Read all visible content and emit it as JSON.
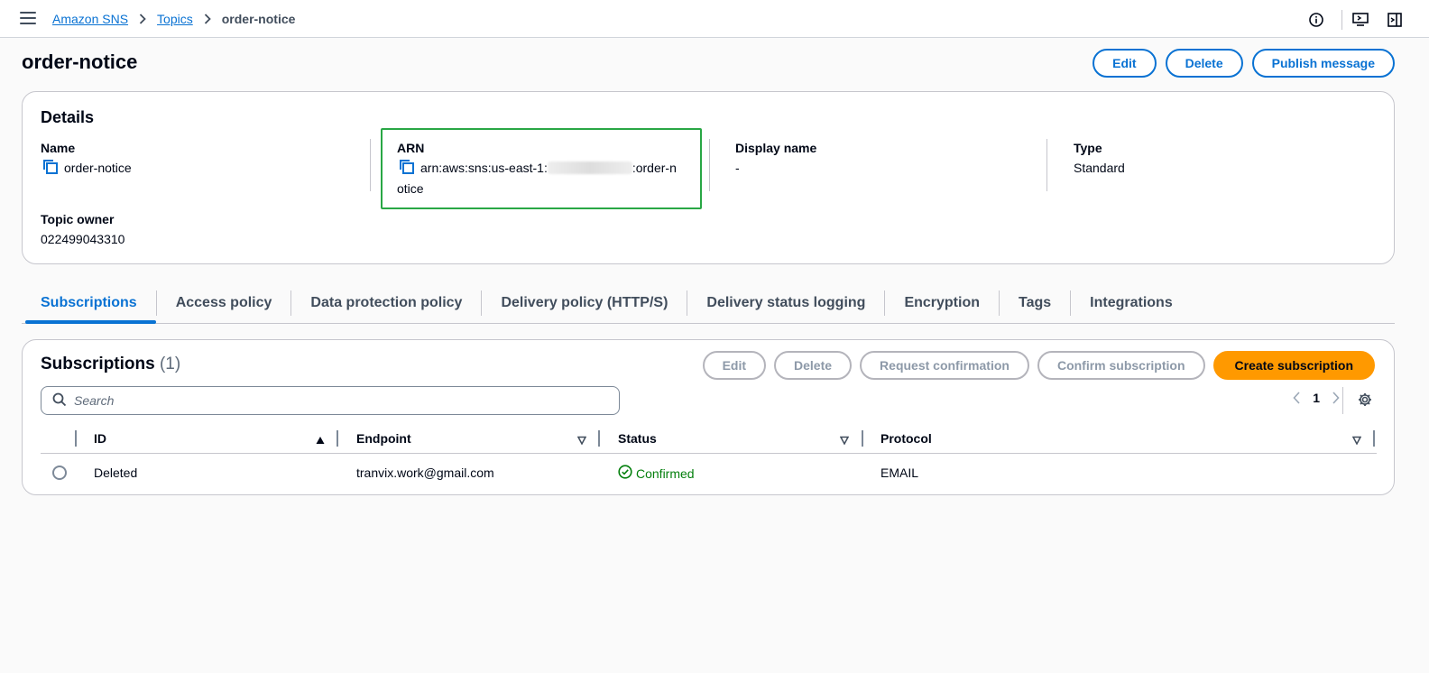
{
  "breadcrumb": {
    "items": [
      "Amazon SNS",
      "Topics"
    ],
    "current": "order-notice"
  },
  "page": {
    "title": "order-notice",
    "actions": [
      "Edit",
      "Delete",
      "Publish message"
    ]
  },
  "details": {
    "title": "Details",
    "name_label": "Name",
    "name_value": "order-notice",
    "arn_label": "ARN",
    "arn_prefix": "arn:aws:sns:us-east-1:",
    "arn_suffix_a": ":order-n",
    "arn_suffix_b": "otice",
    "display_name_label": "Display name",
    "display_name_value": "-",
    "type_label": "Type",
    "type_value": "Standard",
    "owner_label": "Topic owner",
    "owner_value": "022499043310"
  },
  "tabs": [
    "Subscriptions",
    "Access policy",
    "Data protection policy",
    "Delivery policy (HTTP/S)",
    "Delivery status logging",
    "Encryption",
    "Tags",
    "Integrations"
  ],
  "subscriptions": {
    "title": "Subscriptions",
    "count": "(1)",
    "actions": {
      "edit": "Edit",
      "delete": "Delete",
      "request": "Request confirmation",
      "confirm": "Confirm subscription",
      "create": "Create subscription"
    },
    "search_placeholder": "Search",
    "page": "1",
    "columns": [
      "ID",
      "Endpoint",
      "Status",
      "Protocol"
    ],
    "rows": [
      {
        "id": "Deleted",
        "endpoint": "tranvix.work@gmail.com",
        "status": "Confirmed",
        "protocol": "EMAIL"
      }
    ]
  },
  "colors": {
    "link": "#0972d3",
    "primary": "#ff9900",
    "success": "#037f0c",
    "highlight_border": "#29a745"
  }
}
